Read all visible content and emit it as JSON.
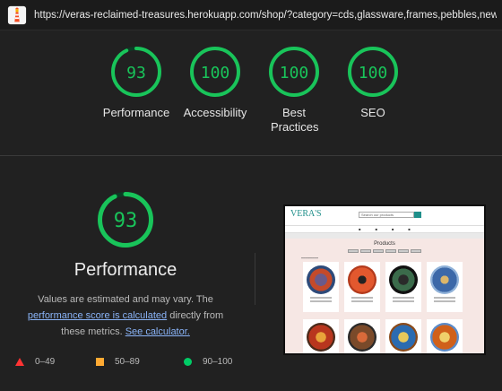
{
  "browser": {
    "url": "https://veras-reclaimed-treasures.herokuapp.com/shop/?category=cds,glassware,frames,pebbles,new,d..."
  },
  "colors": {
    "pass": "#0cce6b",
    "average": "#ffa400",
    "fail": "#ff4e42"
  },
  "scores": [
    {
      "label": "Performance",
      "value": "93"
    },
    {
      "label": "Accessibility",
      "value": "100"
    },
    {
      "label": "Best Practices",
      "value": "100"
    },
    {
      "label": "SEO",
      "value": "100"
    }
  ],
  "performance": {
    "value": "93",
    "title": "Performance",
    "desc_part1": "Values are estimated and may vary. The",
    "link_score": "performance score is calculated",
    "desc_part2": "directly from these metrics.",
    "link_calc": "See calculator."
  },
  "legend": [
    {
      "range": "0–49",
      "icon": "red-triangle-icon"
    },
    {
      "range": "50–89",
      "icon": "orange-square-icon"
    },
    {
      "range": "90–100",
      "icon": "green-circle-icon"
    }
  ],
  "thumbnail": {
    "logo": "VERA'S",
    "search_placeholder": "Search our products",
    "page_title": "Products"
  }
}
